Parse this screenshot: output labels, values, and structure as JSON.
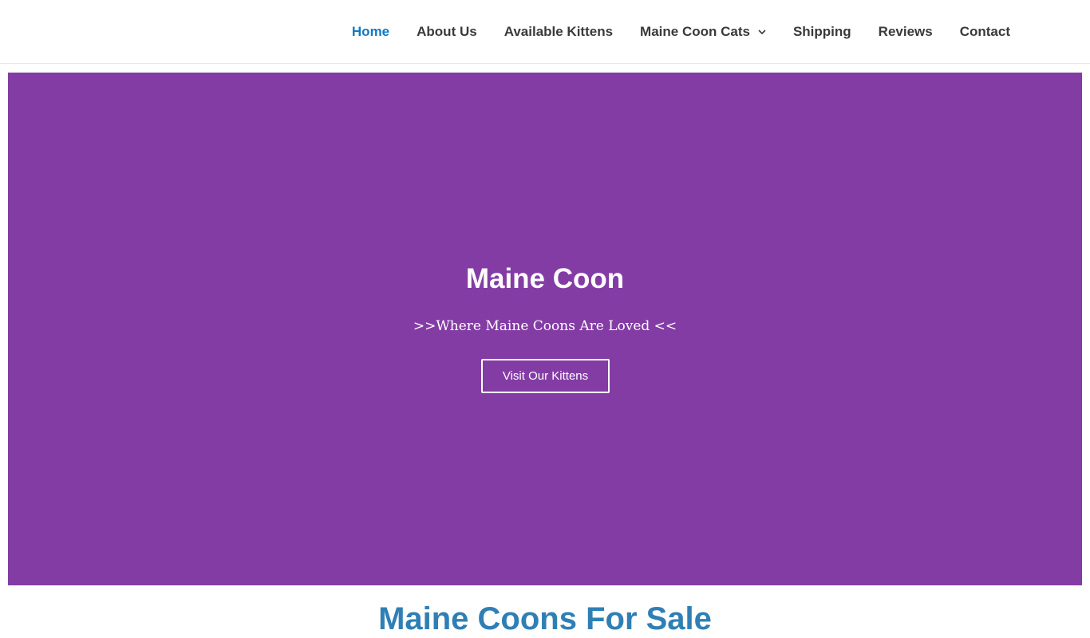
{
  "nav": {
    "items": [
      {
        "label": "Home",
        "active": true
      },
      {
        "label": "About Us"
      },
      {
        "label": "Available Kittens"
      },
      {
        "label": "Maine Coon Cats",
        "has_dropdown": true
      },
      {
        "label": "Shipping"
      },
      {
        "label": "Reviews"
      },
      {
        "label": "Contact"
      }
    ]
  },
  "hero": {
    "title": "Maine Coon",
    "subtitle": ">>Where Maine Coons Are Loved <<",
    "button_label": "Visit Our Kittens",
    "background_color": "#843ca5"
  },
  "section": {
    "heading": "Maine Coons For Sale"
  },
  "colors": {
    "nav_text": "#3a3a3a",
    "nav_active": "#0f7ac4",
    "section_heading": "#2f7fb5"
  }
}
